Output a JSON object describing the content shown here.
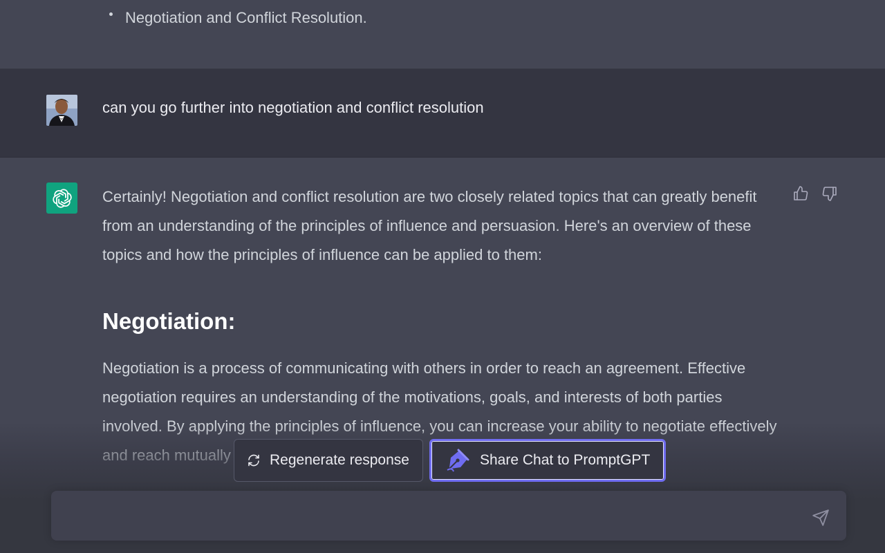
{
  "previous_message": {
    "bullet_item": "Negotiation and Conflict Resolution."
  },
  "user_message": {
    "avatar": "user-photo-avatar",
    "text": "can you go further into negotiation and conflict resolution"
  },
  "assistant_message": {
    "logo": "chatgpt-logo-icon",
    "intro": "Certainly! Negotiation and conflict resolution are two closely related topics that can greatly benefit from an understanding of the principles of influence and persuasion. Here's an overview of these topics and how the principles of influence can be applied to them:",
    "heading": "Negotiation:",
    "paragraph": "Negotiation is a process of communicating with others in order to reach an agreement. Effective negotiation requires an understanding of the motivations, goals, and interests of both parties involved. By applying the principles of influence, you can increase your ability to negotiate effectively and reach mutually beneficial agreements.",
    "feedback": {
      "thumbs_up": "thumbs-up-icon",
      "thumbs_down": "thumbs-down-icon"
    }
  },
  "actions": {
    "regenerate_label": "Regenerate response",
    "share_label": "Share Chat to PromptGPT"
  },
  "composer": {
    "placeholder": "",
    "send_icon": "send-icon"
  },
  "colors": {
    "assistant_bg": "#444654",
    "user_bg": "#343541",
    "accent": "#10a37f",
    "share_border": "#6f6cf0"
  }
}
